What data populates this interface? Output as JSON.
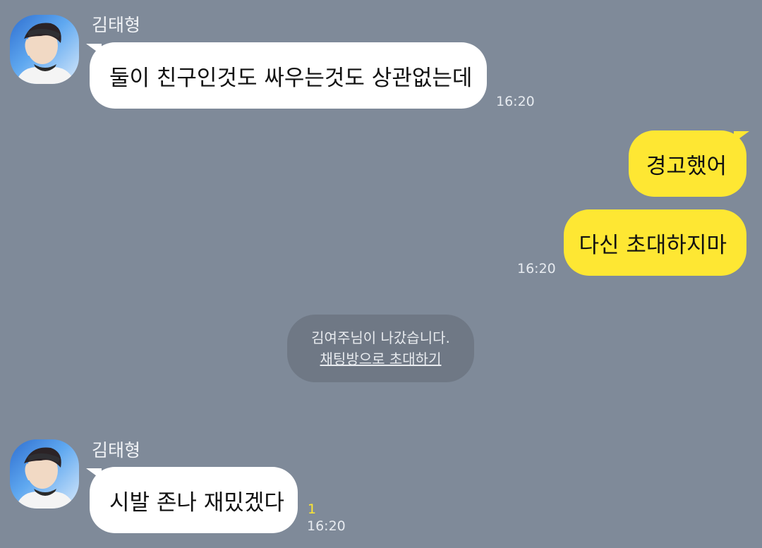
{
  "chat": {
    "messages": [
      {
        "sender": "김태형",
        "text": "둘이 친구인것도 싸우는것도 상관없는데",
        "time": "16:20"
      },
      {
        "text": "경고했어"
      },
      {
        "text": "다신 초대하지마",
        "time": "16:20"
      },
      {
        "sender": "김태형",
        "text": "시발 존나 재밌겠다",
        "unread": "1",
        "time": "16:20"
      }
    ],
    "system_notice": {
      "text": "김여주님이 나갔습니다.",
      "link": "채팅방으로 초대하기"
    }
  },
  "colors": {
    "background": "#7f8a99",
    "incoming_bubble": "#ffffff",
    "outgoing_bubble": "#fee733",
    "unread_count": "#fee733",
    "system_notice": "#6f7885"
  }
}
